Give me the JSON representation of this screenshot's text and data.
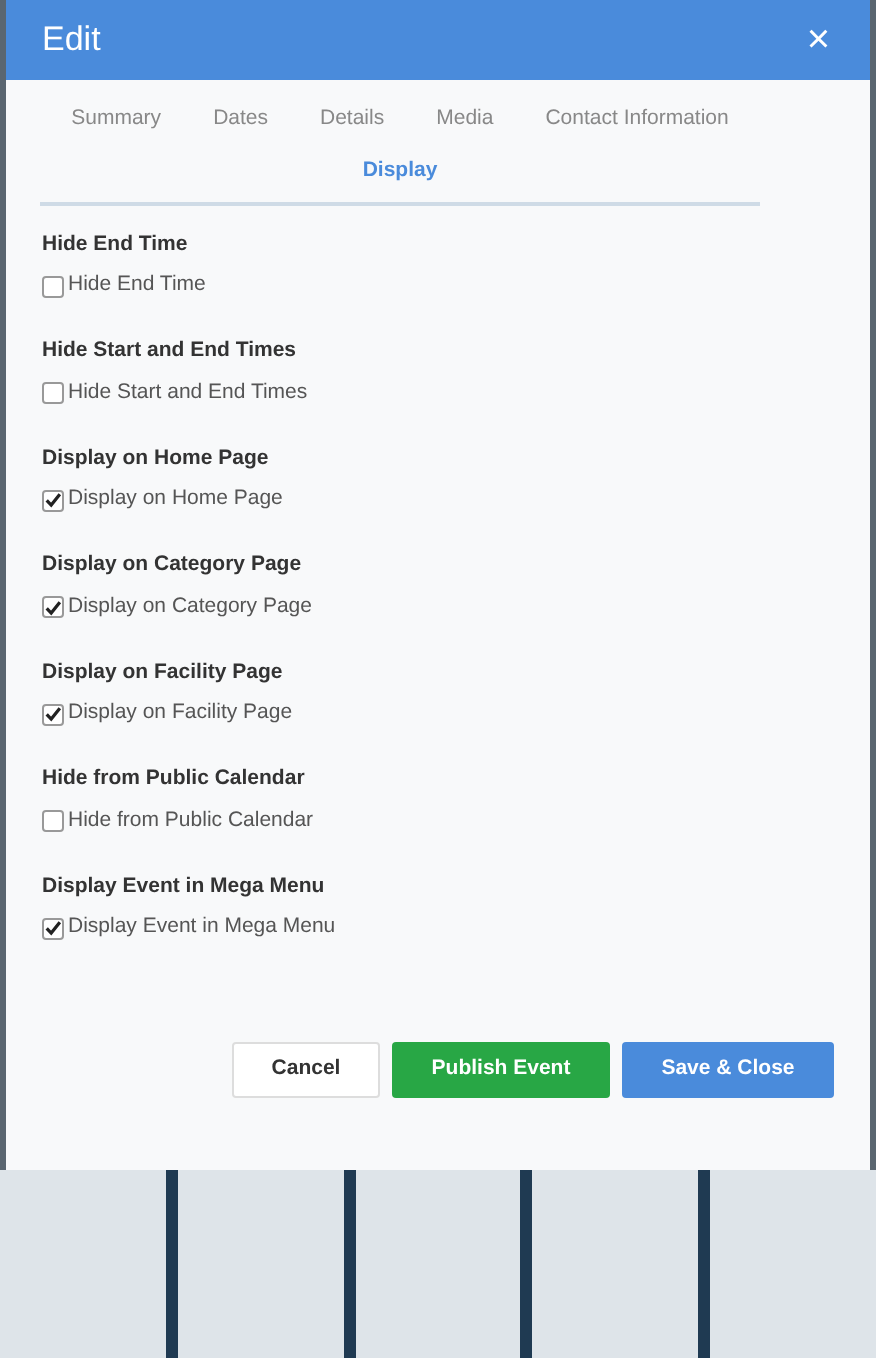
{
  "dialog": {
    "title": "Edit",
    "close": "×"
  },
  "tabs": [
    {
      "label": "Summary",
      "selected": false
    },
    {
      "label": "Dates",
      "selected": false
    },
    {
      "label": "Details",
      "selected": false
    },
    {
      "label": "Media",
      "selected": false
    },
    {
      "label": "Contact Information",
      "selected": false
    },
    {
      "label": "Display",
      "selected": true
    }
  ],
  "options": [
    {
      "heading": "Hide End Time",
      "label": "Hide End Time",
      "checked": false
    },
    {
      "heading": "Hide Start and End Times",
      "label": "Hide Start and End Times",
      "checked": false
    },
    {
      "heading": "Display on Home Page",
      "label": "Display on Home Page",
      "checked": true
    },
    {
      "heading": "Display on Category Page",
      "label": "Display on Category Page",
      "checked": true
    },
    {
      "heading": "Display on Facility Page",
      "label": "Display on Facility Page",
      "checked": true
    },
    {
      "heading": "Hide from Public Calendar",
      "label": "Hide from Public Calendar",
      "checked": false
    },
    {
      "heading": "Display Event in Mega Menu",
      "label": "Display Event in Mega Menu",
      "checked": true
    }
  ],
  "buttons": [
    {
      "kind": "cancel",
      "label": "Cancel"
    },
    {
      "kind": "publish",
      "label": "Publish Event"
    },
    {
      "kind": "save",
      "label": "Save & Close"
    }
  ]
}
